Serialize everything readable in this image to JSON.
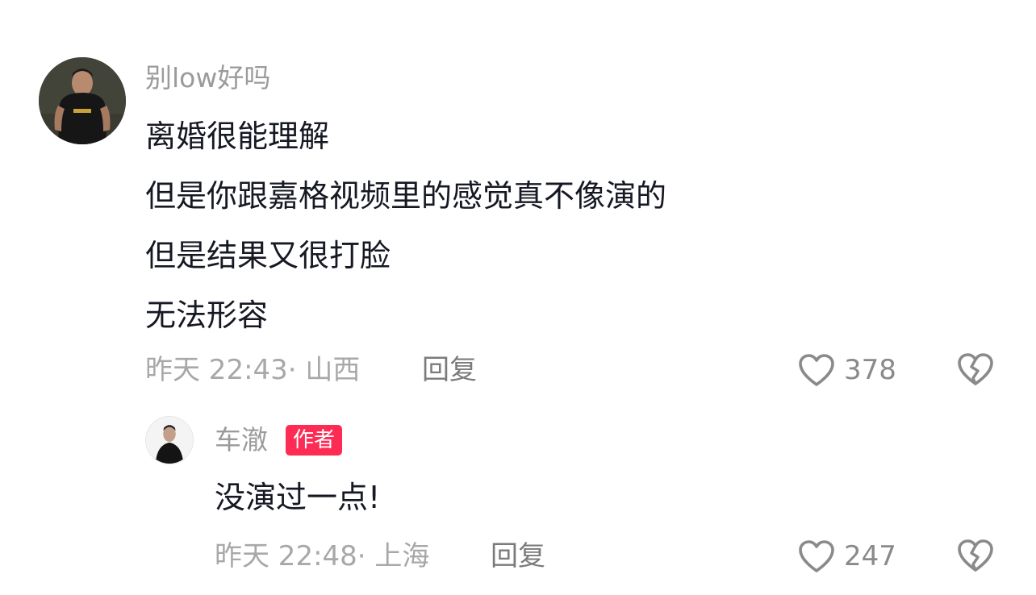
{
  "comment": {
    "username": "别low好吗",
    "lines": [
      "离婚很能理解",
      "但是你跟嘉格视频里的感觉真不像演的",
      "但是结果又很打脸",
      "无法形容"
    ],
    "time_location": "昨天 22:43· 山西",
    "reply_label": "回复",
    "like_count": "378",
    "avatar_icon": "user-avatar-man-tshirt",
    "like_icon": "heart-outline-icon",
    "dislike_icon": "broken-heart-icon"
  },
  "reply": {
    "username": "车澈",
    "badge": "作者",
    "lines": [
      "没演过一点!"
    ],
    "time_location": "昨天 22:48· 上海",
    "reply_label": "回复",
    "like_count": "247",
    "avatar_icon": "user-avatar-man-black-coat"
  },
  "colors": {
    "badge_bg": "#fe2c55",
    "text_primary": "#161823",
    "text_secondary": "#9b9b9b"
  }
}
